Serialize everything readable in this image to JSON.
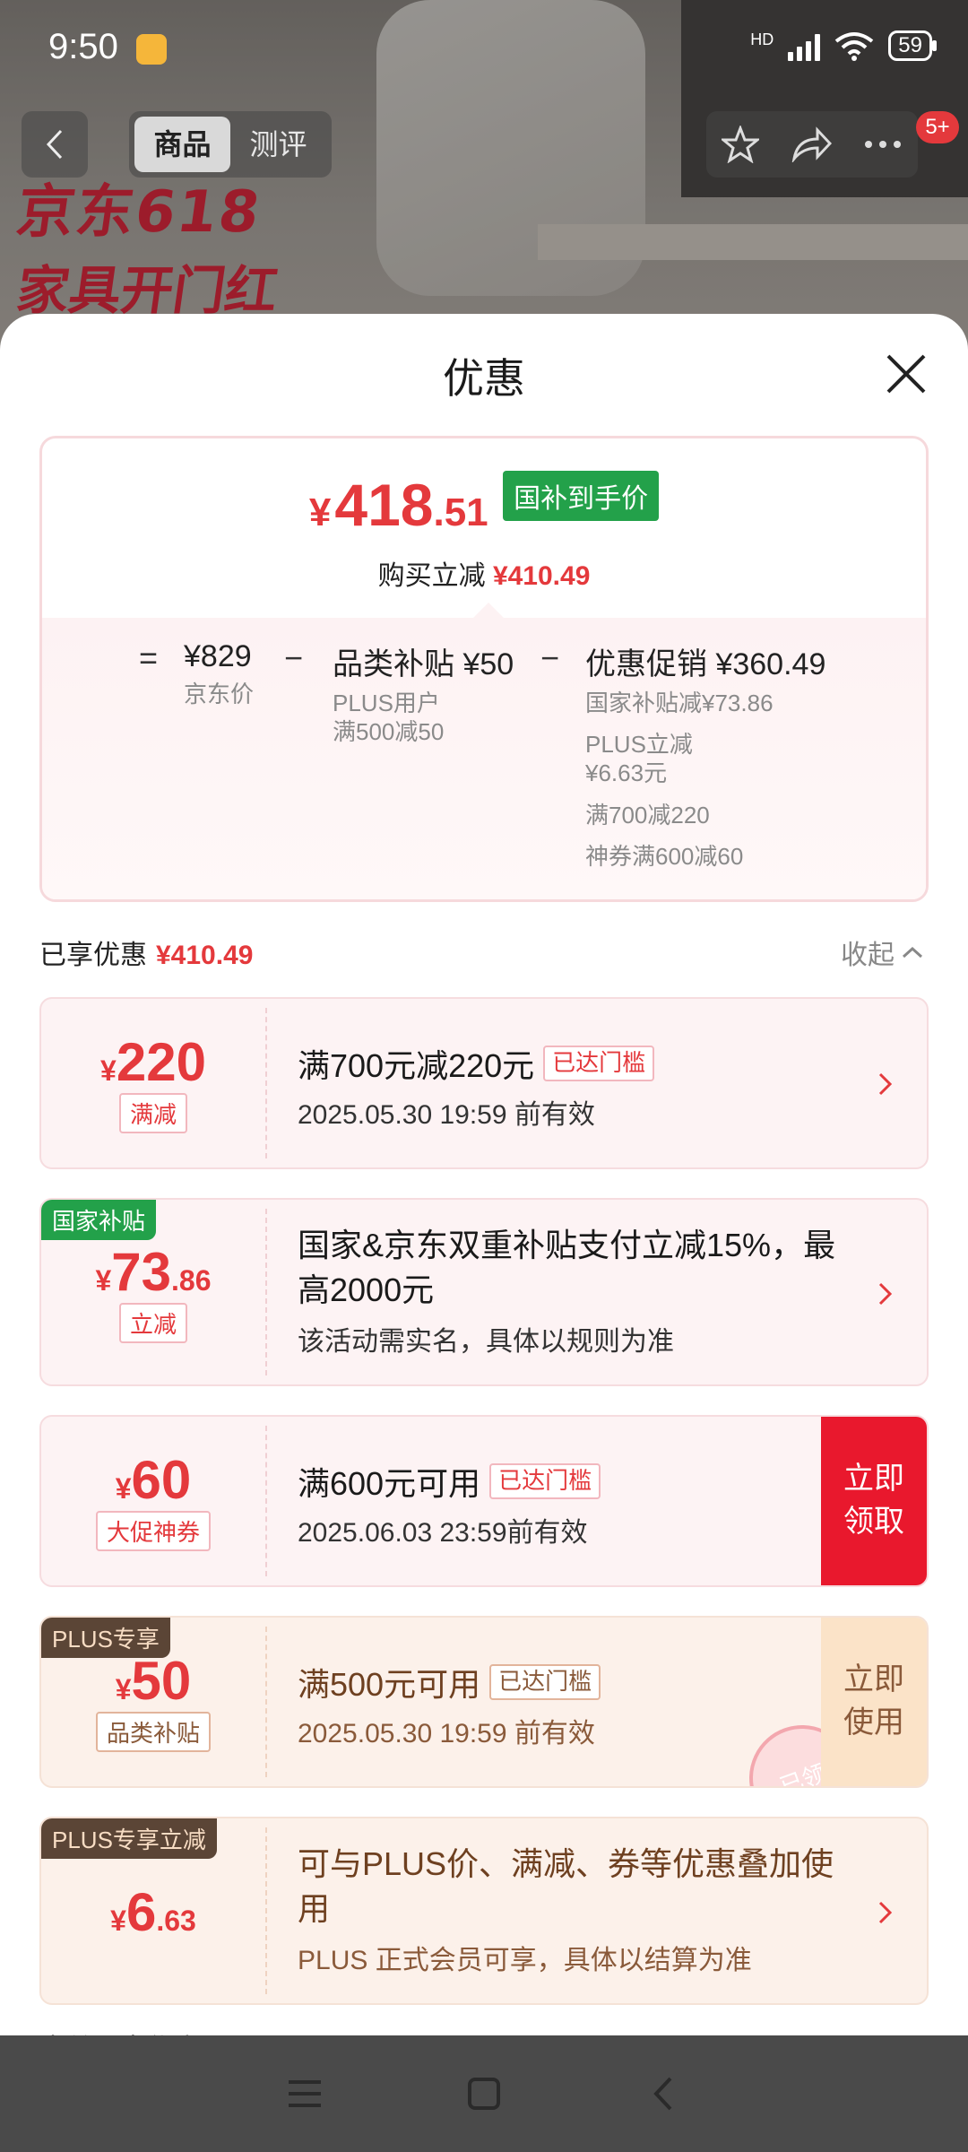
{
  "status_bar": {
    "time": "9:50",
    "network": "HD",
    "battery": "59"
  },
  "nav": {
    "tabs": [
      {
        "label": "商品",
        "active": true
      },
      {
        "label": "测评",
        "active": false
      }
    ],
    "badge": "5+"
  },
  "background": {
    "promo_line1": "京东618",
    "promo_line2": "家具开门红"
  },
  "sheet": {
    "title": "优惠",
    "summary": {
      "currency": "¥",
      "price_int": "418",
      "price_dec": ".51",
      "price_tag": "国补到手价",
      "saving_label": "购买立减",
      "saving_value": "¥410.49",
      "breakdown": {
        "eq": "=",
        "minus": "−",
        "jd_price": "¥829",
        "jd_price_label": "京东价",
        "category_title": "品类补贴 ¥50",
        "category_lines": [
          "PLUS用户",
          "满500减50"
        ],
        "promo_title": "优惠促销 ¥360.49",
        "promo_lines": [
          "国家补贴减¥73.86",
          "PLUS立减\n¥6.63元",
          "满700减220",
          "神券满600减60"
        ]
      }
    },
    "enjoyed_label": "已享优惠",
    "enjoyed_value": "¥410.49",
    "collapse_label": "收起",
    "coupons": [
      {
        "currency": "¥",
        "amount_int": "220",
        "amount_dec": "",
        "tag": "满减",
        "title": "满700元减220元",
        "threshold": "已达门槛",
        "sub": "2025.05.30 19:59 前有效"
      },
      {
        "corner": "国家补贴",
        "currency": "¥",
        "amount_int": "73",
        "amount_dec": ".86",
        "tag": "立减",
        "title": "国家&京东双重补贴支付立减15%，最高2000元",
        "sub": "该活动需实名，具体以规则为准"
      },
      {
        "currency": "¥",
        "amount_int": "60",
        "amount_dec": "",
        "tag": "大促神券",
        "title": "满600元可用",
        "threshold": "已达门槛",
        "sub": "2025.06.03 23:59前有效",
        "action": "立即领取"
      },
      {
        "corner": "PLUS专享",
        "currency": "¥",
        "amount_int": "50",
        "amount_dec": "",
        "tag": "品类补贴",
        "title": "满500元可用",
        "threshold": "已达门槛",
        "sub": "2025.05.30 19:59 前有效",
        "action": "立即使用",
        "stamp": "已领"
      },
      {
        "corner": "PLUS专享立减",
        "currency": "¥",
        "amount_int": "6",
        "amount_dec": ".63",
        "title": "可与PLUS价、满减、券等优惠叠加使用",
        "sub": "PLUS 正式会员可享，具体以结算为准"
      }
    ],
    "peek_text": "本单不享优惠"
  },
  "colors": {
    "accent_red": "#e4393c",
    "green_tag": "#23a14a",
    "plus_brown": "#5b4536"
  }
}
